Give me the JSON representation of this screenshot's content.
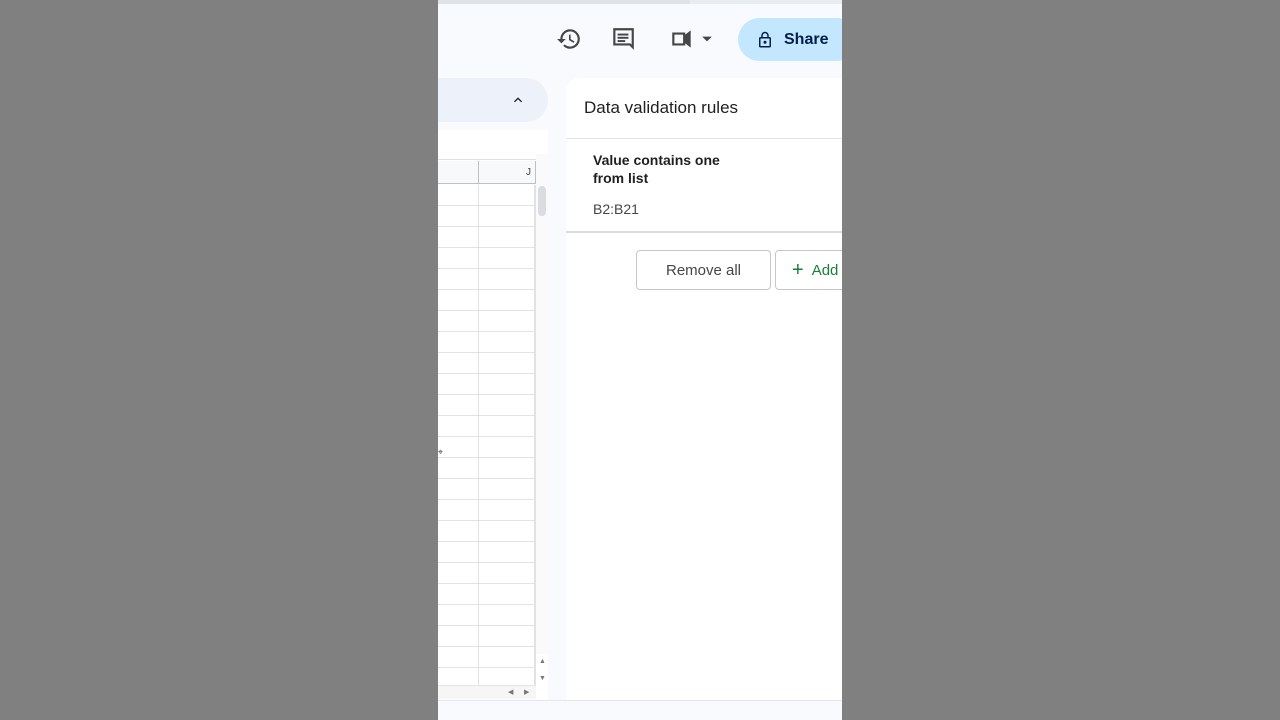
{
  "toolbar": {
    "icons": [
      "history-icon",
      "comment-icon",
      "meet-video-icon",
      "dropdown-caret-icon",
      "lock-icon"
    ],
    "share_label": "Share"
  },
  "grid": {
    "column_header": "J"
  },
  "panel": {
    "title": "Data validation rules",
    "rule": {
      "title": "Value contains one from list",
      "range": "B2:B21"
    },
    "remove_all_label": "Remove all",
    "add_rule_label": "Add"
  },
  "colors": {
    "share_bg": "#c2e7ff",
    "add_text": "#188038",
    "page_bg": "#f8fafd"
  }
}
